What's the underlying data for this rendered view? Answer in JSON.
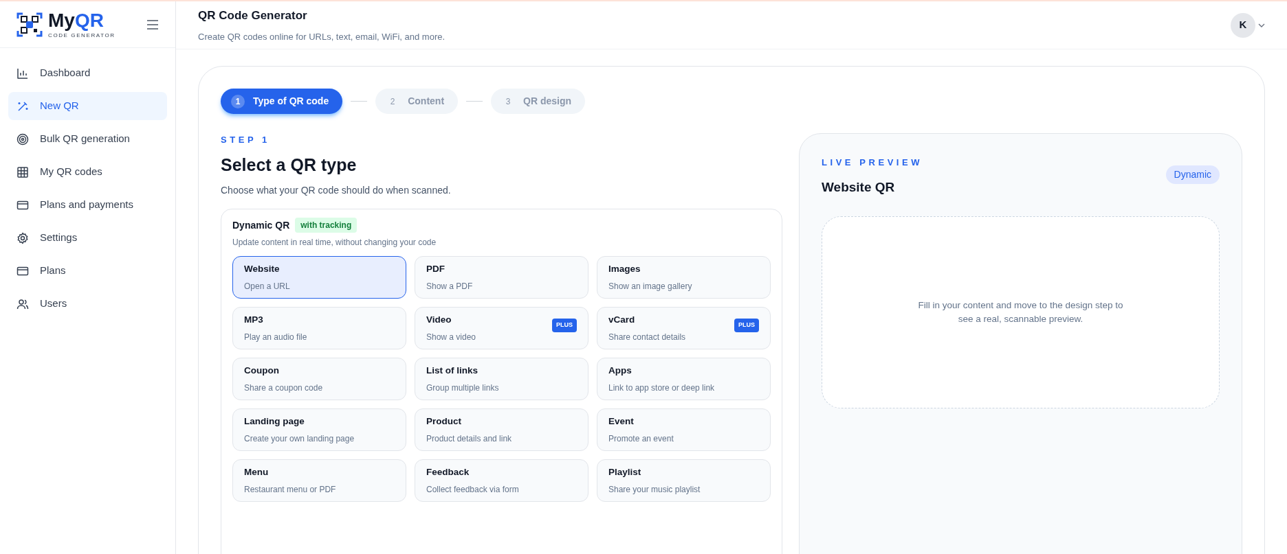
{
  "brand": {
    "name_part_1": "My",
    "name_part_2": "QR",
    "tagline": "CODE GENERATOR"
  },
  "sidebar": {
    "items": [
      {
        "label": "Dashboard",
        "selected": false
      },
      {
        "label": "New QR",
        "selected": true
      },
      {
        "label": "Bulk QR generation",
        "selected": false
      },
      {
        "label": "My QR codes",
        "selected": false
      },
      {
        "label": "Plans and payments",
        "selected": false
      },
      {
        "label": "Settings",
        "selected": false
      },
      {
        "label": "Plans",
        "selected": false
      },
      {
        "label": "Users",
        "selected": false
      }
    ]
  },
  "header": {
    "title": "QR Code Generator",
    "subtitle": "Create QR codes online for URLs, text, email, WiFi, and more.",
    "avatar": "K"
  },
  "steps": [
    {
      "number": "1",
      "label": "Type of QR code",
      "selected": true
    },
    {
      "number": "2",
      "label": "Content",
      "selected": false
    },
    {
      "number": "3",
      "label": "QR design",
      "selected": false
    }
  ],
  "step_eyebrow": "STEP 1",
  "heading": "Select a QR type",
  "description": "Choose what your QR code should do when scanned.",
  "dynamic_section": {
    "title": "Dynamic QR",
    "badge": "with tracking",
    "subtitle": "Update content in real time, without changing your code",
    "types": [
      {
        "title": "Website",
        "description": "Open a URL",
        "selected": true
      },
      {
        "title": "PDF",
        "description": "Show a PDF",
        "selected": false
      },
      {
        "title": "Images",
        "description": "Show an image gallery",
        "selected": false
      },
      {
        "title": "MP3",
        "description": "Play an audio file",
        "selected": false
      },
      {
        "title": "Video",
        "description": "Show a video",
        "selected": false,
        "badge": "PLUS"
      },
      {
        "title": "vCard",
        "description": "Share contact details",
        "selected": false,
        "badge": "PLUS"
      },
      {
        "title": "Coupon",
        "description": "Share a coupon code",
        "selected": false
      },
      {
        "title": "List of links",
        "description": "Group multiple links",
        "selected": false
      },
      {
        "title": "Apps",
        "description": "Link to app store or deep link",
        "selected": false
      },
      {
        "title": "Landing page",
        "description": "Create your own landing page",
        "selected": false
      },
      {
        "title": "Product",
        "description": "Product details and link",
        "selected": false
      },
      {
        "title": "Event",
        "description": "Promote an event",
        "selected": false
      },
      {
        "title": "Menu",
        "description": "Restaurant menu or PDF",
        "selected": false
      },
      {
        "title": "Feedback",
        "description": "Collect feedback via form",
        "selected": false
      },
      {
        "title": "Playlist",
        "description": "Share your music playlist",
        "selected": false
      }
    ]
  },
  "preview": {
    "eyebrow": "LIVE PREVIEW",
    "title": "Website QR",
    "badge": "Dynamic",
    "placeholder_text": "Fill in your content and move to the design step to see a real, scannable preview."
  }
}
